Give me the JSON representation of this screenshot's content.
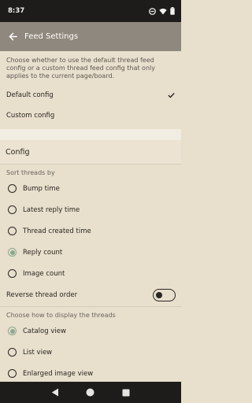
{
  "status_bar": {
    "time": "8:37"
  },
  "app_bar": {
    "title": "Feed Settings"
  },
  "description": "Choose whether to use the default thread feed config or a custom thread feed config that only applies to the current page/board.",
  "config_options": [
    {
      "label": "Default config",
      "selected": true
    },
    {
      "label": "Custom config",
      "selected": false
    }
  ],
  "section_title": "Config",
  "sort": {
    "label": "Sort threads by",
    "options": [
      {
        "label": "Bump time",
        "checked": false
      },
      {
        "label": "Latest reply time",
        "checked": false
      },
      {
        "label": "Thread created time",
        "checked": false
      },
      {
        "label": "Reply count",
        "checked": true
      },
      {
        "label": "Image count",
        "checked": false
      }
    ]
  },
  "reverse": {
    "label": "Reverse thread order",
    "on": false
  },
  "display": {
    "label": "Choose how to display the threads",
    "options": [
      {
        "label": "Catalog view",
        "checked": true
      },
      {
        "label": "List view",
        "checked": false
      },
      {
        "label": "Enlarged image view",
        "checked": false
      }
    ]
  },
  "icons": {
    "back": "arrow-back-icon",
    "check": "check-icon",
    "nav_back": "triangle-back-icon",
    "nav_home": "circle-home-icon",
    "nav_recents": "square-recents-icon"
  },
  "colors": {
    "accent": "#8aa890",
    "app_bar": "#8f887e",
    "background": "#e8dfcd"
  }
}
